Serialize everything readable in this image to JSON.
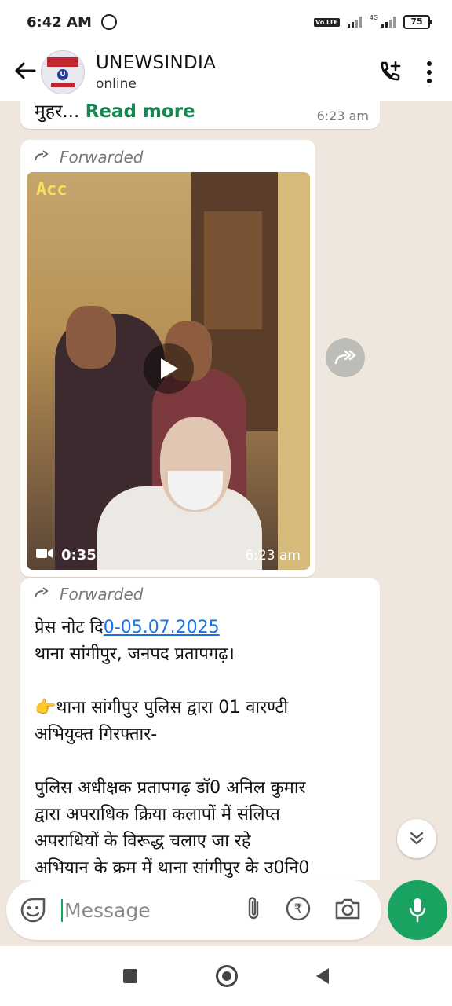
{
  "status_bar": {
    "time": "6:42 AM",
    "volte": "Vo LTE",
    "network": "4G",
    "battery": "75"
  },
  "header": {
    "contact_name": "UNEWSINDIA",
    "contact_status": "online",
    "avatar_logo_text": "CRIME VIRODHI",
    "icons": [
      "back-arrow-icon",
      "add-call-icon",
      "more-vert-icon"
    ]
  },
  "messages": {
    "previous": {
      "text_tail": "मुहर...",
      "read_more": "Read more",
      "time": "6:23 am"
    },
    "video": {
      "forwarded": "Forwarded",
      "overlay_tag": "Acc",
      "duration": "0:35",
      "time": "6:23 am"
    },
    "press_note": {
      "forwarded": "Forwarded",
      "line1_prefix": "प्रेस नोट दि",
      "line1_date": "0-05.07.2025",
      "line2": "थाना सांगीपुर, जनपद प्रतापगढ़।",
      "line3_emoji": "👉",
      "line3": "थाना सांगीपुर पुलिस द्वारा 01 वारण्टी",
      "line4": "अभियुक्त गिरफ्तार-",
      "line5": "पुलिस अधीक्षक प्रतापगढ़ डॉ0 अनिल कुमार",
      "line6": "द्वारा अपराधिक क्रिया कलापों में संलिप्त",
      "line7": "अपराधियों के विरूद्ध चलाए जा रहे",
      "line8": "अभियान के क्रम में थाना सांगीपुर के उ0नि0"
    }
  },
  "composer": {
    "placeholder": "Message",
    "value": ""
  },
  "colors": {
    "accent": "#1aa260",
    "link": "#1a73e8",
    "read_more": "#198754",
    "chat_bg": "#efe7dd"
  }
}
